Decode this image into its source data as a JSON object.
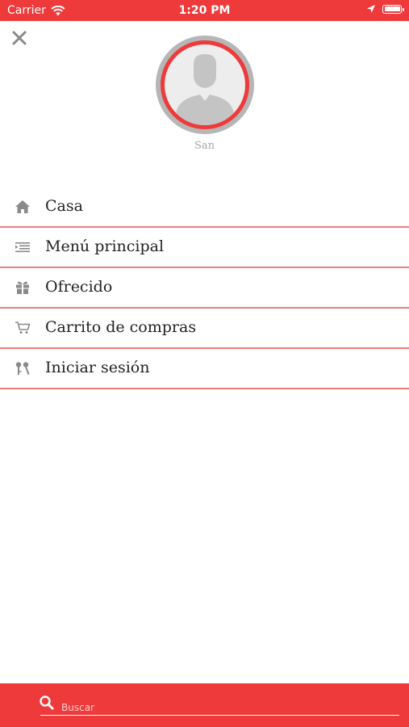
{
  "status_bar": {
    "carrier": "Carrier",
    "time": "1:20 PM"
  },
  "profile": {
    "username": "San"
  },
  "menu": {
    "items": [
      {
        "label": "Casa",
        "icon": "home-icon"
      },
      {
        "label": "Menú principal",
        "icon": "menu-list-icon"
      },
      {
        "label": "Ofrecido",
        "icon": "gift-icon"
      },
      {
        "label": "Carrito de compras",
        "icon": "cart-icon"
      },
      {
        "label": "Iniciar sesión",
        "icon": "login-keys-icon"
      }
    ]
  },
  "search": {
    "placeholder": "Buscar"
  },
  "colors": {
    "accent": "#ee3a3a",
    "divider": "#ef7b7b",
    "icon_gray": "#8a8a8a"
  }
}
